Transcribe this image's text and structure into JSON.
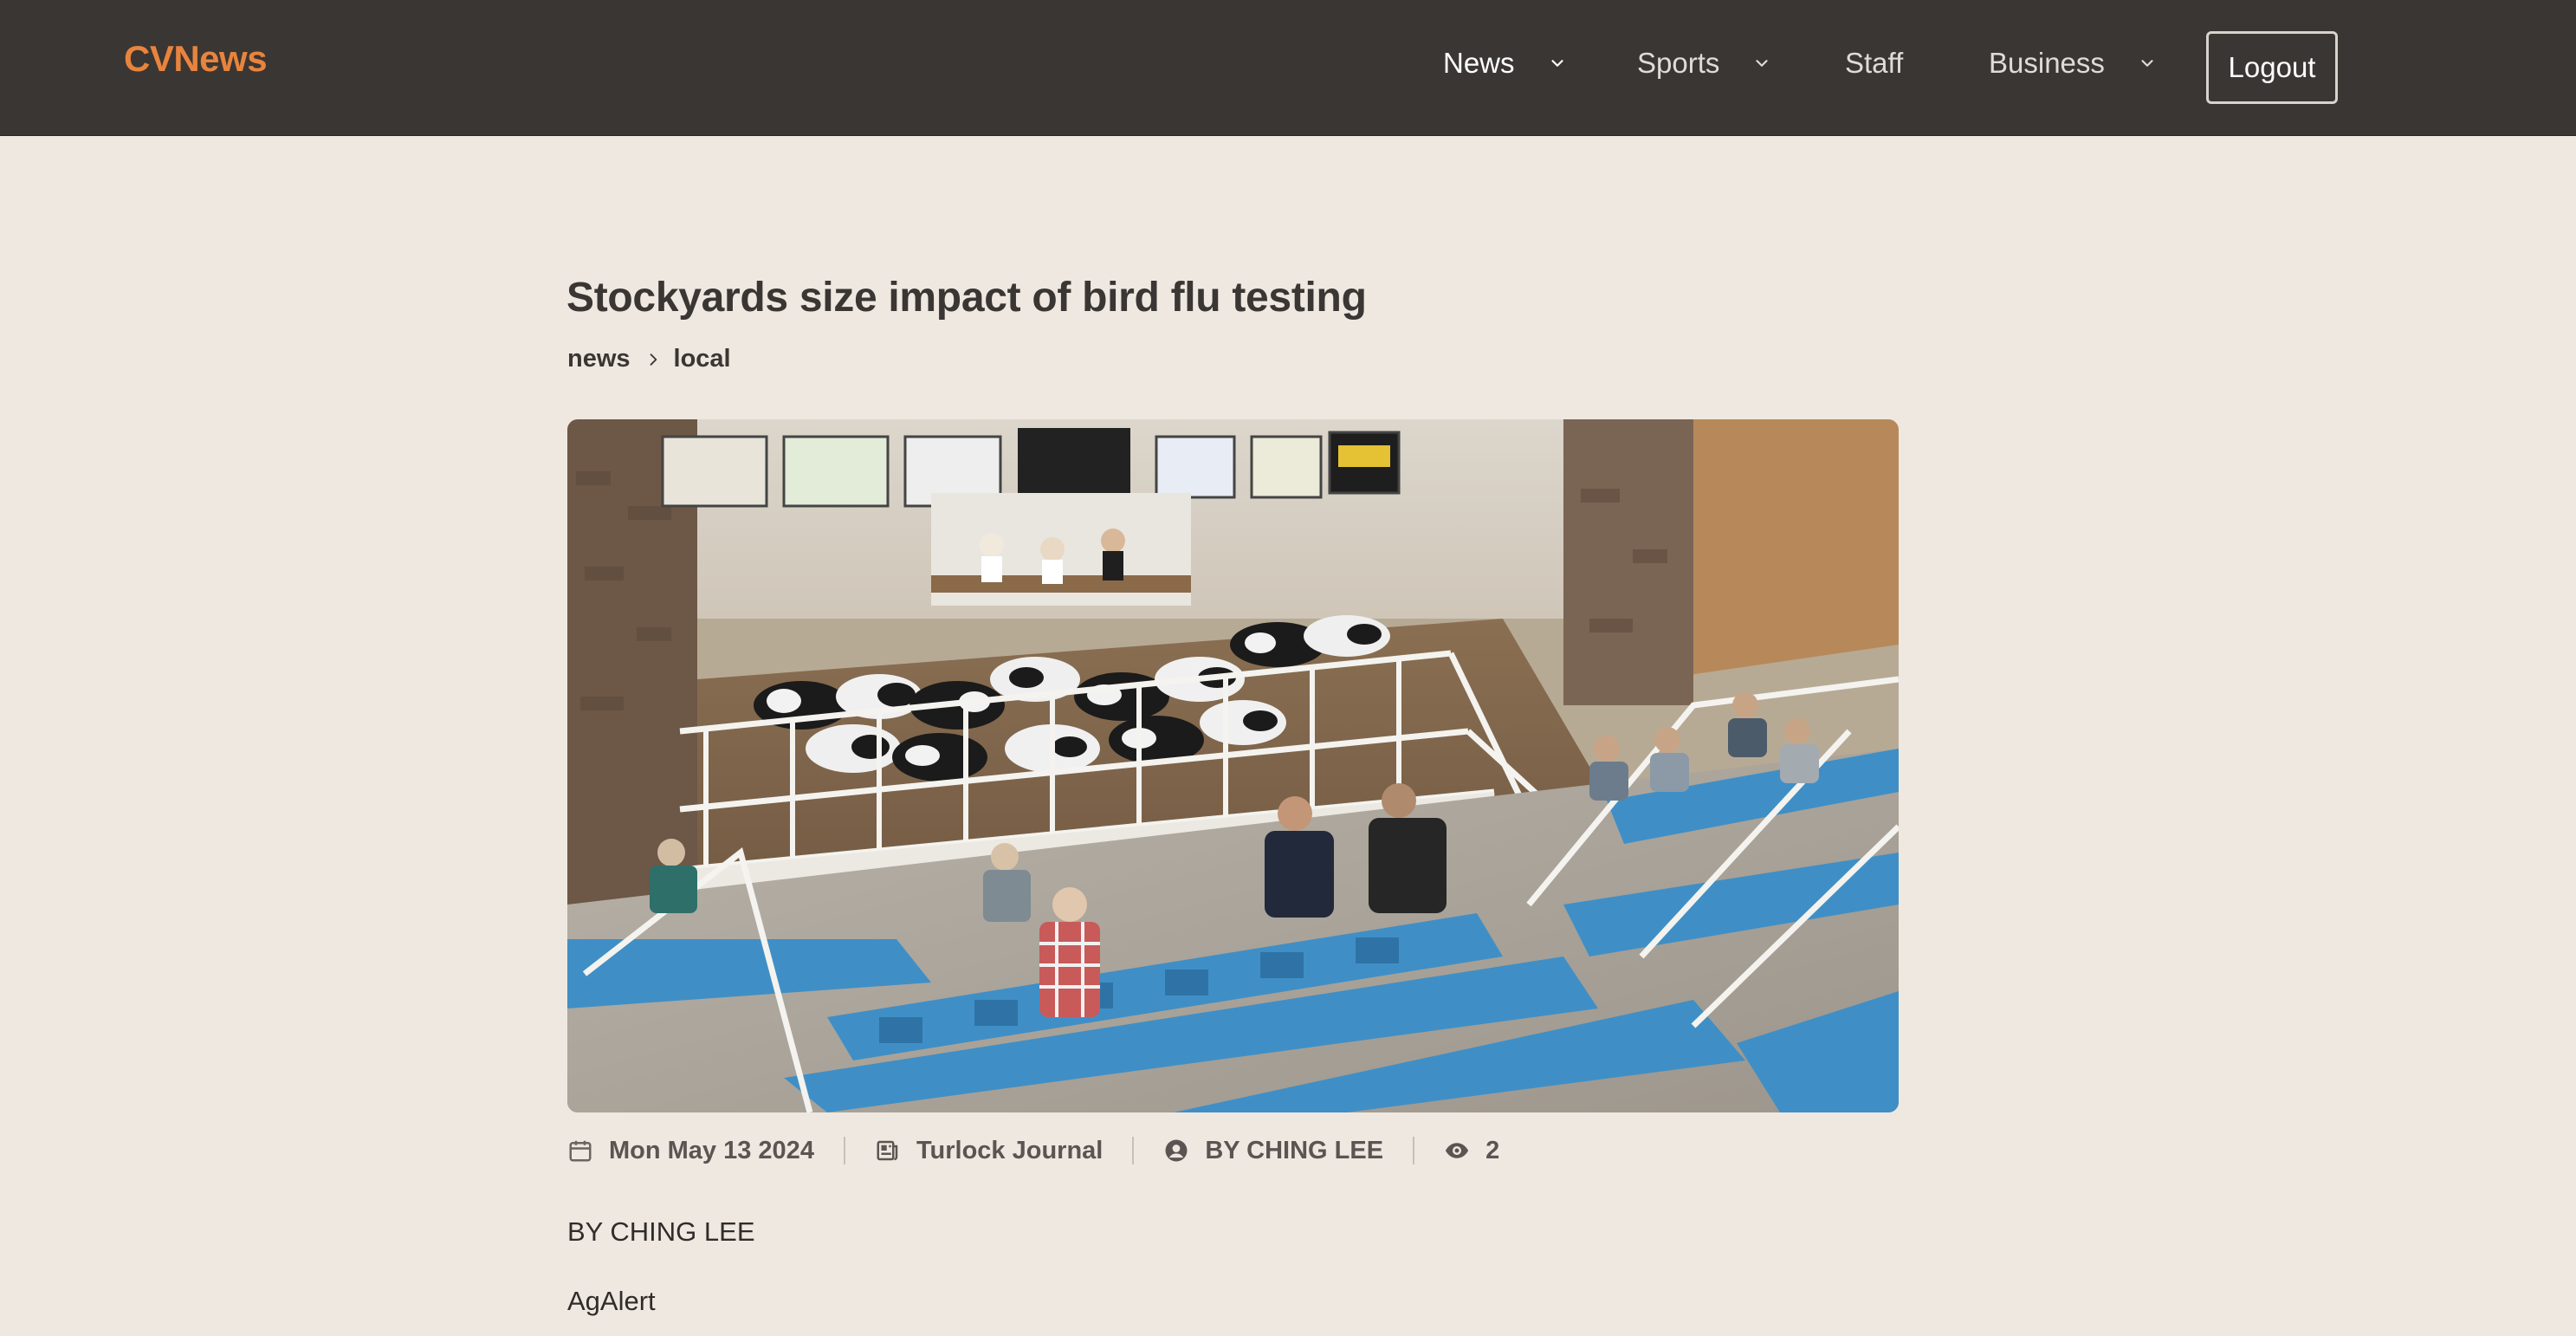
{
  "nav": {
    "brand": "CVNews",
    "items": [
      {
        "label": "News",
        "has_dropdown": true,
        "active": true
      },
      {
        "label": "Sports",
        "has_dropdown": true,
        "active": false
      },
      {
        "label": "Staff",
        "has_dropdown": false,
        "active": false
      },
      {
        "label": "Business",
        "has_dropdown": true,
        "active": false
      }
    ],
    "logout_label": "Logout"
  },
  "article": {
    "title": "Stockyards size impact of bird flu testing",
    "breadcrumb": [
      "news",
      "local"
    ],
    "image_alt": "Livestock auction arena with cattle in pen and buyers in blue stadium seats",
    "meta": {
      "date": "Mon May 13 2024",
      "source": "Turlock Journal",
      "author": "BY CHING LEE",
      "views": "2"
    },
    "paragraphs": [
      "BY CHING LEE",
      "AgAlert"
    ]
  },
  "colors": {
    "navbar_bg": "#3a3633",
    "brand": "#E8843D",
    "page_bg": "#EFE8E0",
    "seat_blue": "#3f8fc6"
  },
  "icons": {
    "date": "calendar-icon",
    "source": "newspaper-icon",
    "author": "user-circle-icon",
    "views": "eye-icon",
    "dropdown": "chevron-down-icon",
    "breadcrumb_separator": "chevron-right-icon"
  }
}
